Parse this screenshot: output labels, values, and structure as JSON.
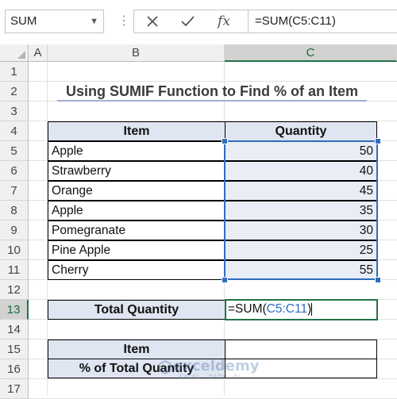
{
  "formula_bar": {
    "name_box": "SUM",
    "cancel_icon": "x-icon",
    "enter_icon": "check-icon",
    "fx_label": "fx",
    "formula": "=SUM(C5:C11)"
  },
  "columns": [
    "A",
    "B",
    "C"
  ],
  "rows": [
    "1",
    "2",
    "3",
    "4",
    "5",
    "6",
    "7",
    "8",
    "9",
    "10",
    "11",
    "12",
    "13",
    "14",
    "15",
    "16",
    "17"
  ],
  "sheet": {
    "title": "Using SUMIF Function to Find % of an Item",
    "table_headers": {
      "item": "Item",
      "quantity": "Quantity"
    },
    "items": [
      {
        "name": "Apple",
        "quantity": "50"
      },
      {
        "name": "Strawberry",
        "quantity": "40"
      },
      {
        "name": "Orange",
        "quantity": "45"
      },
      {
        "name": "Apple",
        "quantity": "35"
      },
      {
        "name": "Pomegranate",
        "quantity": "30"
      },
      {
        "name": "Pine Apple",
        "quantity": "25"
      },
      {
        "name": "Cherry",
        "quantity": "55"
      }
    ],
    "total_label": "Total Quantity",
    "total_formula": {
      "prefix": "=SUM(",
      "ref": "C5:C11",
      "suffix": ")"
    },
    "lookup_labels": {
      "item": "Item",
      "percent": "% of Total Quantity"
    }
  },
  "watermark": {
    "name": "exceldemy",
    "tagline": "EXCEL · DATA · BI"
  },
  "colors": {
    "header_fill": "#dfe5f1",
    "selection": "#2f6cbf",
    "active": "#217346"
  }
}
